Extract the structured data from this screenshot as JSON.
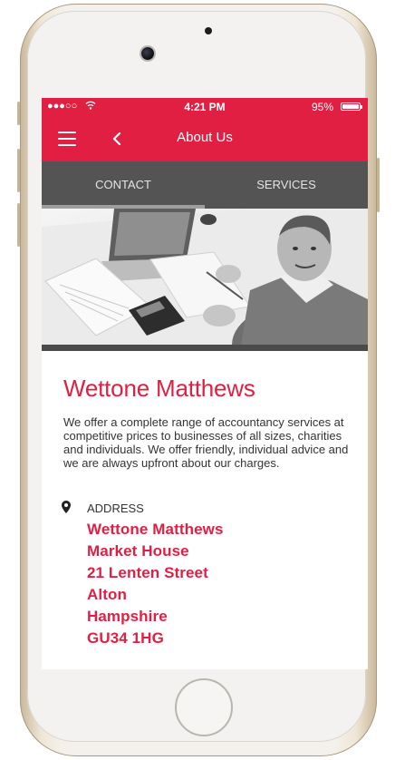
{
  "status_bar": {
    "signal": "●●●○○",
    "time": "4:21 PM",
    "battery": "95%"
  },
  "app_bar": {
    "title": "About Us",
    "menu_icon": "hamburger-icon",
    "back_icon": "chevron-left-icon"
  },
  "tabs": [
    {
      "label": "CONTACT",
      "active": true
    },
    {
      "label": "SERVICES",
      "active": false
    }
  ],
  "hero": {
    "description_icon": "photo-accountant"
  },
  "company": {
    "name": "Wettone Matthews",
    "description": "We offer a complete range of accountancy services at competitive prices to businesses of all sizes, charities and individuals. We offer friendly, individual advice and we are always upfront about our charges."
  },
  "address": {
    "label": "ADDRESS",
    "icon": "map-pin-icon",
    "lines": [
      "Wettone Matthews",
      "Market House",
      "21 Lenten Street",
      "Alton",
      "Hampshire",
      "GU34 1HG"
    ]
  },
  "colors": {
    "accent": "#e11f42",
    "tab_bar": "#545454"
  }
}
